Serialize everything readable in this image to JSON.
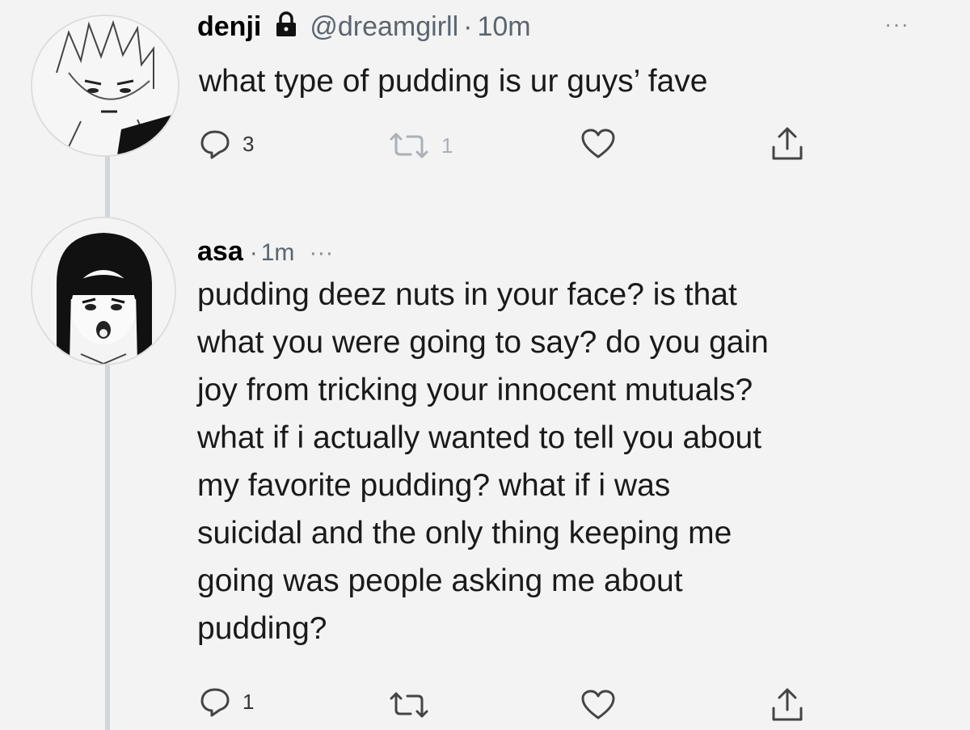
{
  "tweet1": {
    "name": "denji",
    "handle": "@dreamgirll",
    "separator": "·",
    "time": "10m",
    "text": "what type of pudding is ur guys’ fave",
    "actions": {
      "replies": "3",
      "retweets": "1",
      "likes": ""
    },
    "more": "···"
  },
  "tweet2": {
    "name": "asa",
    "separator": "·",
    "time": "1m",
    "more": "···",
    "text": "pudding deez nuts in your face? is that\nwhat you were going to say? do you gain\njoy from tricking your innocent mutuals?\nwhat if i actually wanted to tell you about\nmy favorite pudding? what if i was\nsuicidal and the only thing keeping me\ngoing was people asking me about\npudding?",
    "actions": {
      "replies": "1",
      "retweets": "",
      "likes": ""
    }
  },
  "icons": {
    "reply": "reply-icon",
    "retweet": "retweet-icon",
    "like": "heart-icon",
    "share": "share-icon",
    "lock": "lock-icon"
  },
  "colors": {
    "background": "#f3f3f3",
    "muted": "#5b6570",
    "thread_line": "#cfd6dc"
  }
}
